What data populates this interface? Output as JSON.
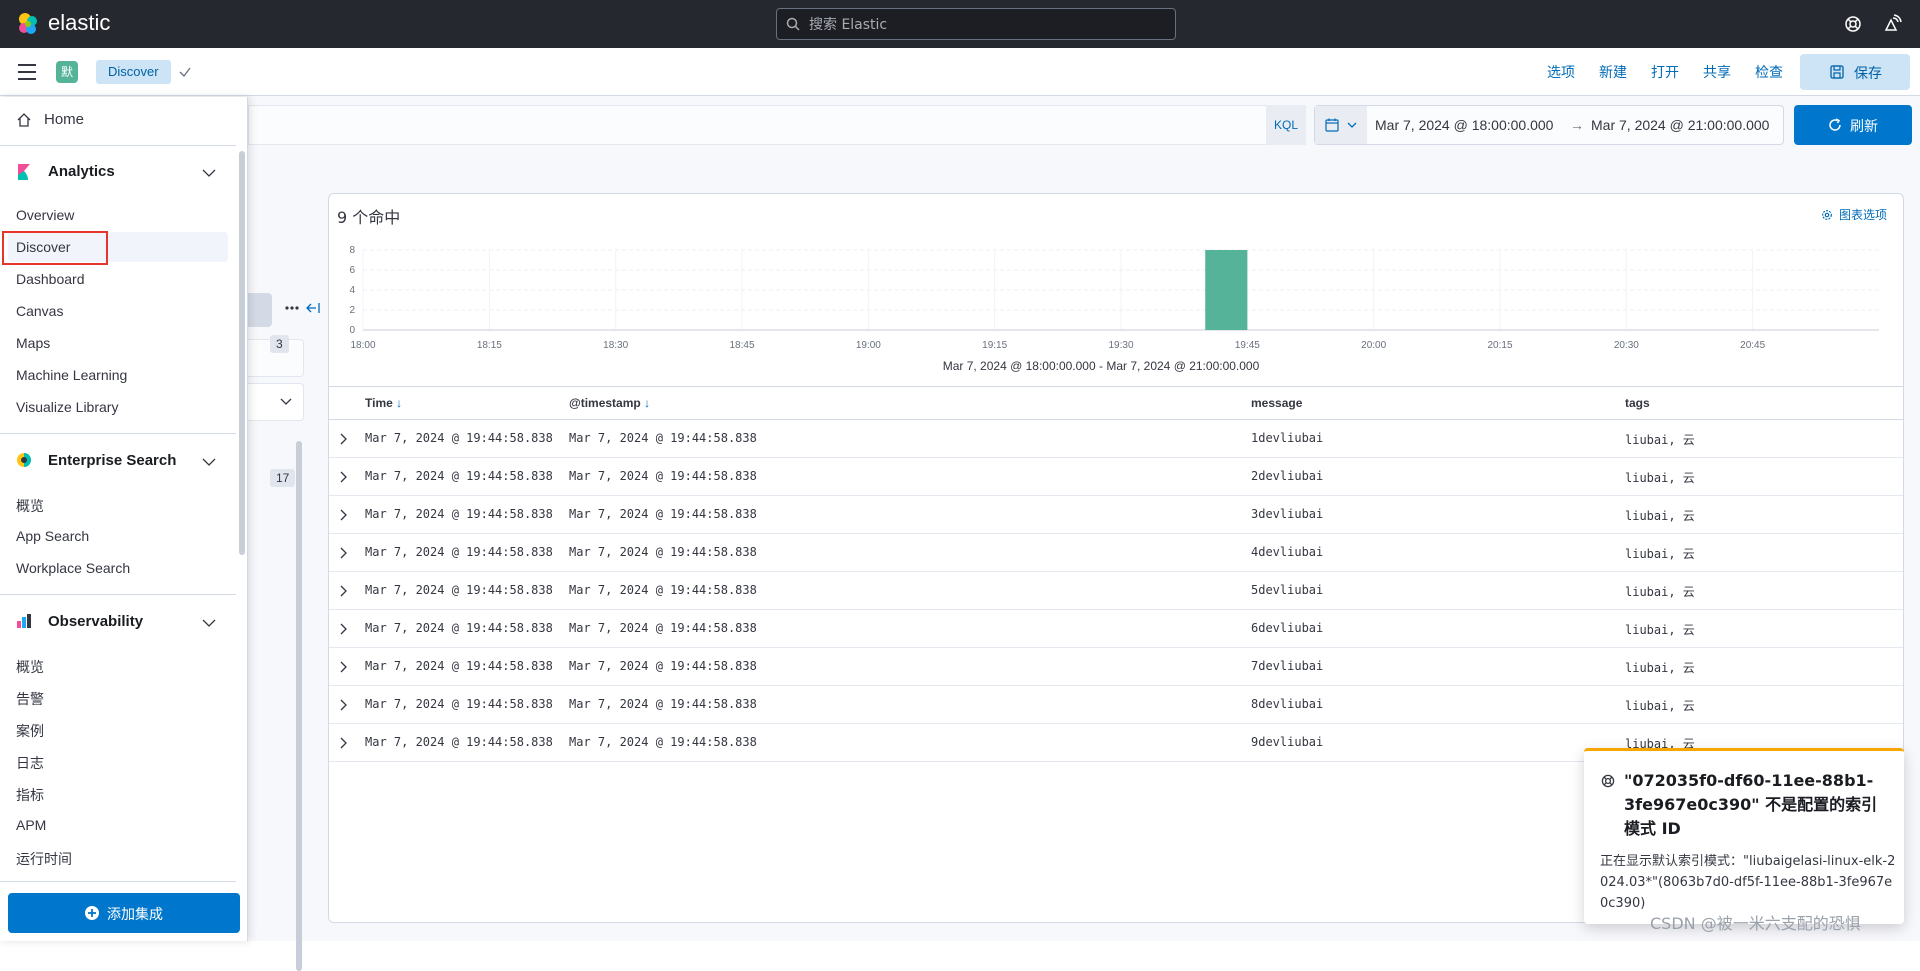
{
  "header": {
    "brand": "elastic",
    "search_placeholder": "搜索 Elastic",
    "icons": [
      "help-icon",
      "newsfeed-icon"
    ]
  },
  "subheader": {
    "space_initial": "默",
    "breadcrumb": "Discover",
    "links": {
      "options": "选项",
      "new": "新建",
      "open": "打开",
      "share": "共享",
      "inspect": "检查"
    },
    "save_label": "保存"
  },
  "query": {
    "language": "KQL",
    "time_start": "Mar 7, 2024 @ 18:00:00.000",
    "time_arrow": "→",
    "time_end": "Mar 7, 2024 @ 21:00:00.000",
    "refresh_label": "刷新"
  },
  "sidebar_counts": [
    "3",
    "17"
  ],
  "main": {
    "hits": "9 个命中",
    "chart_options": "图表选项"
  },
  "chart_data": {
    "type": "bar",
    "x_ticks": [
      "18:00",
      "18:15",
      "18:30",
      "18:45",
      "19:00",
      "19:15",
      "19:30",
      "19:45",
      "20:00",
      "20:15",
      "20:30",
      "20:45"
    ],
    "y_ticks": [
      "0",
      "2",
      "4",
      "6",
      "8"
    ],
    "ylim": [
      0,
      8
    ],
    "bars": [
      {
        "x": "19:40",
        "value": 9
      }
    ],
    "xlabel": "Mar 7, 2024 @ 18:00:00.000 - Mar 7, 2024 @ 21:00:00.000",
    "color": "#54b399",
    "grid": true
  },
  "table": {
    "columns": [
      "Time",
      "@timestamp",
      "message",
      "tags"
    ],
    "rows": [
      {
        "time": "Mar 7, 2024 @ 19:44:58.838",
        "timestamp": "Mar 7, 2024 @ 19:44:58.838",
        "message": "1devliubai",
        "tags": "liubai, 云"
      },
      {
        "time": "Mar 7, 2024 @ 19:44:58.838",
        "timestamp": "Mar 7, 2024 @ 19:44:58.838",
        "message": "2devliubai",
        "tags": "liubai, 云"
      },
      {
        "time": "Mar 7, 2024 @ 19:44:58.838",
        "timestamp": "Mar 7, 2024 @ 19:44:58.838",
        "message": "3devliubai",
        "tags": "liubai, 云"
      },
      {
        "time": "Mar 7, 2024 @ 19:44:58.838",
        "timestamp": "Mar 7, 2024 @ 19:44:58.838",
        "message": "4devliubai",
        "tags": "liubai, 云"
      },
      {
        "time": "Mar 7, 2024 @ 19:44:58.838",
        "timestamp": "Mar 7, 2024 @ 19:44:58.838",
        "message": "5devliubai",
        "tags": "liubai, 云"
      },
      {
        "time": "Mar 7, 2024 @ 19:44:58.838",
        "timestamp": "Mar 7, 2024 @ 19:44:58.838",
        "message": "6devliubai",
        "tags": "liubai, 云"
      },
      {
        "time": "Mar 7, 2024 @ 19:44:58.838",
        "timestamp": "Mar 7, 2024 @ 19:44:58.838",
        "message": "7devliubai",
        "tags": "liubai, 云"
      },
      {
        "time": "Mar 7, 2024 @ 19:44:58.838",
        "timestamp": "Mar 7, 2024 @ 19:44:58.838",
        "message": "8devliubai",
        "tags": "liubai, 云"
      },
      {
        "time": "Mar 7, 2024 @ 19:44:58.838",
        "timestamp": "Mar 7, 2024 @ 19:44:58.838",
        "message": "9devliubai",
        "tags": "liubai, 云"
      }
    ]
  },
  "nav": {
    "home": "Home",
    "groups": [
      {
        "title": "Analytics",
        "items": [
          "Overview",
          "Discover",
          "Dashboard",
          "Canvas",
          "Maps",
          "Machine Learning",
          "Visualize Library"
        ]
      },
      {
        "title": "Enterprise Search",
        "items": [
          "概览",
          "App Search",
          "Workplace Search"
        ]
      },
      {
        "title": "Observability",
        "items": [
          "概览",
          "告警",
          "案例",
          "日志",
          "指标",
          "APM",
          "运行时间"
        ]
      }
    ],
    "active_item": "Discover",
    "add_integrations": "添加集成"
  },
  "toast": {
    "title": "\"072035f0-df60-11ee-88b1-3fe967e0c390\" 不是配置的索引模式 ID",
    "body": "正在显示默认索引模式：\"liubaigelasi-linux-elk-2024.03*\"(8063b7d0-df5f-11ee-88b1-3fe967e0c390)"
  },
  "watermark": "CSDN @被一米六支配的恐惧",
  "colors": {
    "accent": "#0077cc",
    "bar": "#54b399",
    "header_bg": "#25282f",
    "warning": "#f5a700"
  }
}
